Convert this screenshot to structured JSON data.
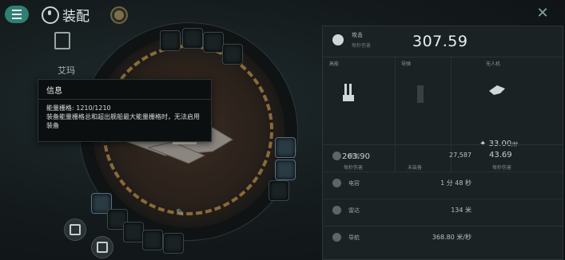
{
  "header": {
    "title": "装配"
  },
  "sidebar": {
    "ship_name": "艾玛"
  },
  "info_popup": {
    "title": "信息",
    "line1": "能量栅格: 1210/1210",
    "line2": "装备能量栅格总和超出舰船最大能量栅格时，无法启用",
    "line3": "装备"
  },
  "stats": {
    "attack": {
      "label": "攻击",
      "sub": "每秒伤害",
      "value": "307.59"
    },
    "columns": [
      {
        "label": "高能",
        "value": "263.90",
        "sub": "每秒伤害"
      },
      {
        "label": "导弹",
        "value": "",
        "sub": "未装备"
      },
      {
        "label": "无人机",
        "value": "33.00",
        "value2": "43.69",
        "sub": "每秒伤害",
        "unit": "/秒"
      }
    ],
    "rows": [
      {
        "label": "防御",
        "value": "27,587"
      },
      {
        "label": "电容",
        "value": "1 分 48 秒"
      },
      {
        "label": "雷达",
        "value": "134 米"
      },
      {
        "label": "导航",
        "value": "368.80 米/秒"
      }
    ]
  }
}
